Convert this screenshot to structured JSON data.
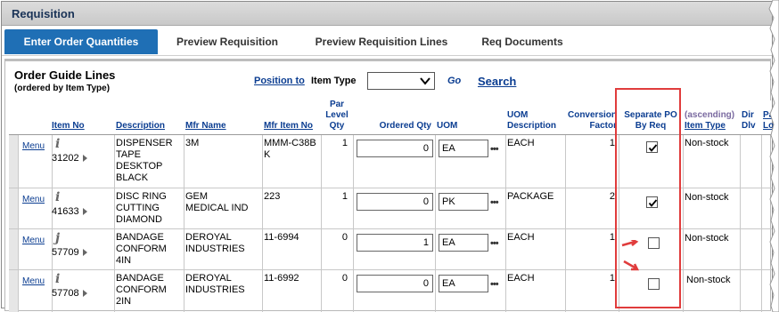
{
  "section": {
    "title": "Requisition"
  },
  "tabs": [
    {
      "label": "Enter Order Quantities",
      "active": true
    },
    {
      "label": "Preview Requisition",
      "active": false
    },
    {
      "label": "Preview Requisition Lines",
      "active": false
    },
    {
      "label": "Req Documents",
      "active": false
    }
  ],
  "order_guide": {
    "title": "Order Guide Lines",
    "subtitle": "(ordered by Item Type)",
    "position_to_link": "Position to",
    "position_to_field": "Item Type",
    "position_select_value": "",
    "go_label": "Go",
    "search_label": "Search"
  },
  "columns": {
    "item_no": "Item No",
    "description": "Description",
    "mfr_name": "Mfr Name",
    "mfr_item_no": "Mfr Item No",
    "par_level_qty": "Par Level Qty",
    "ordered_qty": "Ordered Qty",
    "uom": "UOM",
    "uom_description": "UOM Description",
    "conversion_factor": "Conversion Factor",
    "separate_po": "Separate PO By Req",
    "item_type_sort": "(ascending)",
    "item_type": "Item Type",
    "dir_dlv": "Dir Dlv",
    "par_loc": "Par Loc"
  },
  "rows": [
    {
      "menu": "Menu",
      "icon": "i",
      "item_no": "31202",
      "description": "DISPENSER TAPE DESKTOP BLACK",
      "mfr_name": "3M",
      "mfr_item_no": "MMM-C38BK",
      "par_level_qty": "1",
      "ordered_qty": "0",
      "uom": "EA",
      "uom_description": "EACH",
      "conversion_factor": "1",
      "separate_po": true,
      "item_type": "Non-stock"
    },
    {
      "menu": "Menu",
      "icon": "i",
      "item_no": "41633",
      "description": "DISC RING CUTTING DIAMOND",
      "mfr_name": "GEM MEDICAL IND",
      "mfr_item_no": "223",
      "par_level_qty": "1",
      "ordered_qty": "0",
      "uom": "PK",
      "uom_description": "PACKAGE",
      "conversion_factor": "2",
      "separate_po": true,
      "item_type": "Non-stock"
    },
    {
      "menu": "Menu",
      "icon": "j",
      "item_no": "57709",
      "description": "BANDAGE CONFORM 4IN",
      "mfr_name": "DEROYAL INDUSTRIES",
      "mfr_item_no": "11-6994",
      "par_level_qty": "0",
      "ordered_qty": "1",
      "uom": "EA",
      "uom_description": "EACH",
      "conversion_factor": "1",
      "separate_po": false,
      "item_type": "Non-stock"
    },
    {
      "menu": "Menu",
      "icon": "i",
      "item_no": "57708",
      "description": "BANDAGE CONFORM 2IN",
      "mfr_name": "DEROYAL INDUSTRIES",
      "mfr_item_no": "11-6992",
      "par_level_qty": "0",
      "ordered_qty": "0",
      "uom": "EA",
      "uom_description": "EACH",
      "conversion_factor": "1",
      "separate_po": false,
      "item_type": "Non-stock"
    }
  ],
  "colors": {
    "tab_active": "#1f6fb5",
    "link": "#0b3d91",
    "highlight": "#e03c3c"
  }
}
